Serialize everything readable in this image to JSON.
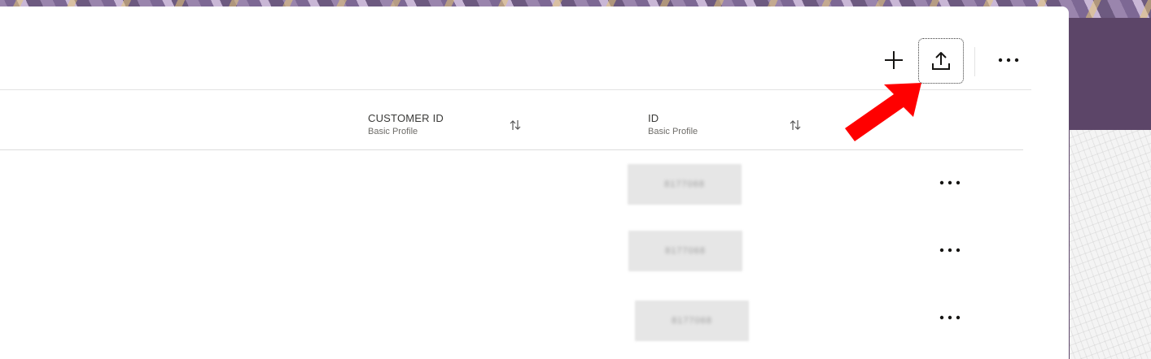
{
  "colors": {
    "accent_arrow": "#ff0000",
    "panel_bg": "#ffffff",
    "side_bg": "#5c4568",
    "text_primary": "#3a3a38",
    "text_secondary": "#6e6c68"
  },
  "toolbar": {
    "buttons": [
      {
        "icon": "plus-icon"
      },
      {
        "icon": "upload-icon"
      },
      {
        "icon": "more-horizontal-icon"
      }
    ]
  },
  "grid": {
    "columns": [
      {
        "title": "CUSTOMER ID",
        "subtitle": "Basic Profile",
        "sort_icon": "sort-arrows-icon"
      },
      {
        "title": "ID",
        "subtitle": "Basic Profile",
        "sort_icon": "sort-arrows-icon"
      }
    ],
    "rows": [
      {
        "customer_id": "",
        "id": "8177068",
        "action_icon": "more-horizontal-icon"
      },
      {
        "customer_id": "",
        "id": "8177068",
        "action_icon": "more-horizontal-icon"
      },
      {
        "customer_id": "",
        "id": "8177068",
        "action_icon": "more-horizontal-icon"
      }
    ]
  },
  "annotation": {
    "icon": "red-arrow-icon"
  }
}
